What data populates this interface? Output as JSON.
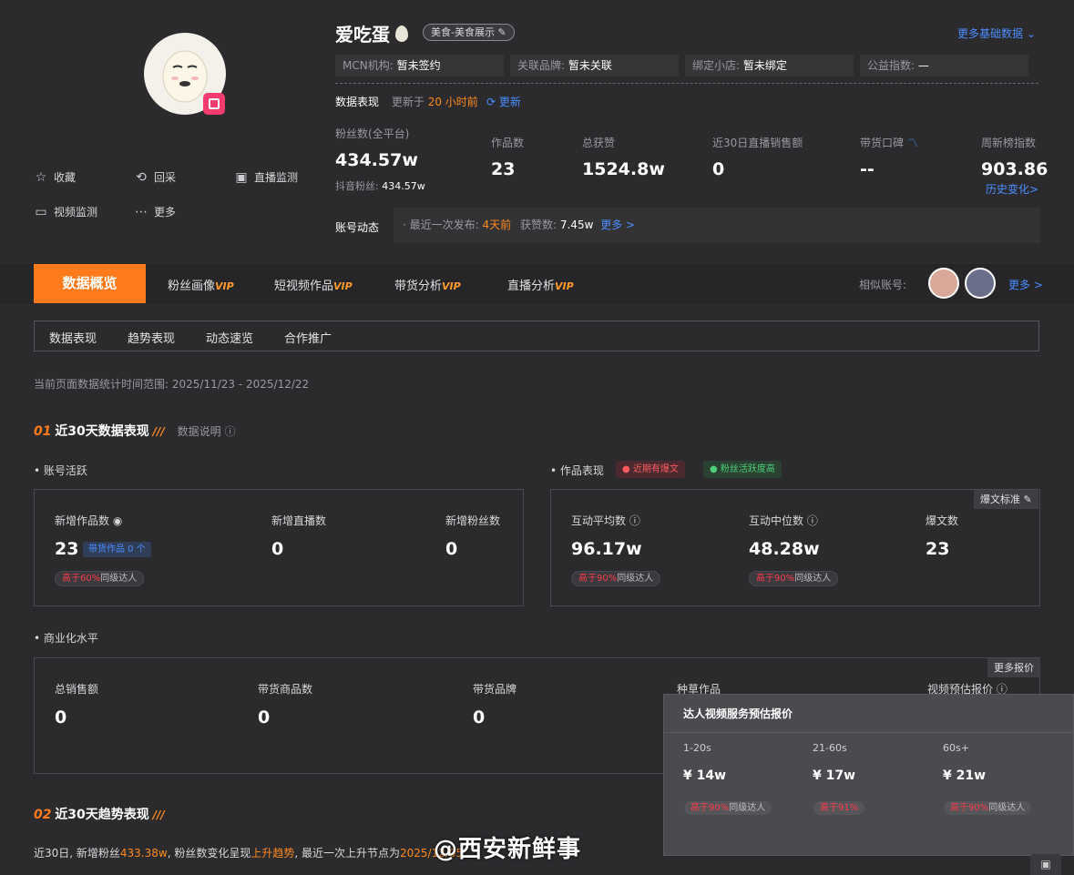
{
  "profile": {
    "name": "爱吃蛋",
    "category_tag": "美食-美食展示",
    "more_basic": "更多基础数据"
  },
  "actions": [
    {
      "label": "收藏",
      "icon": "star-icon"
    },
    {
      "label": "回采",
      "icon": "refresh-icon"
    },
    {
      "label": "直播监测",
      "icon": "live-icon"
    },
    {
      "label": "视频监测",
      "icon": "monitor-icon"
    },
    {
      "label": "更多",
      "icon": "more-icon"
    }
  ],
  "info": [
    {
      "label": "MCN机构:",
      "value": "暂未签约"
    },
    {
      "label": "关联品牌:",
      "value": "暂未关联"
    },
    {
      "label": "绑定小店:",
      "value": "暂未绑定"
    },
    {
      "label": "公益指数:",
      "value": "—"
    }
  ],
  "perf": {
    "title": "数据表现",
    "updated_prefix": "更新于",
    "updated_value": "20 小时前",
    "update_btn": "更新"
  },
  "stats": {
    "fans_label": "粉丝数(全平台)",
    "fans_value": "434.57w",
    "douyin_label": "抖音粉丝:",
    "douyin_value": "434.57w",
    "works_label": "作品数",
    "works_value": "23",
    "likes_label": "总获赞",
    "likes_value": "1524.8w",
    "live_sales_label": "近30日直播销售额",
    "live_sales_value": "0",
    "reputation_label": "带货口碑",
    "reputation_value": "--",
    "weekly_label": "周新榜指数",
    "weekly_value": "903.86",
    "history_link": "历史变化>"
  },
  "dynamics": {
    "label": "账号动态",
    "last_post_label": "· 最近一次发布:",
    "last_post_value": "4天前",
    "likes_label": "获赞数:",
    "likes_value": "7.45w",
    "more": "更多 >"
  },
  "tabs": {
    "active": "数据概览",
    "items": [
      "粉丝画像",
      "短视频作品",
      "带货分析",
      "直播分析"
    ],
    "vip": "VIP",
    "similar_label": "相似账号:",
    "similar_more": "更多 >"
  },
  "subtabs": [
    "数据表现",
    "趋势表现",
    "动态速览",
    "合作推广"
  ],
  "range_text": "当前页面数据统计时间范围: 2025/11/23 - 2025/12/22",
  "section1": {
    "num": "01",
    "title": "近30天数据表现",
    "desc": "数据说明"
  },
  "account_activity": {
    "title": "账号活跃",
    "new_works_label": "新增作品数",
    "new_works_value": "23",
    "goods_works": "带货作品 0 个",
    "new_works_pill_pre": "高于",
    "new_works_pill_pct": "60%",
    "new_works_pill_post": "同级达人",
    "new_live_label": "新增直播数",
    "new_live_value": "0",
    "new_fans_label": "新增粉丝数",
    "new_fans_value": "0"
  },
  "works_perf": {
    "title": "作品表现",
    "badge1": "近期有爆文",
    "badge2": "粉丝活跃度高",
    "standard_btn": "爆文标准",
    "avg_label": "互动平均数",
    "avg_value": "96.17w",
    "avg_pill_pre": "高于",
    "avg_pill_pct": "90%",
    "avg_pill_post": "同级达人",
    "median_label": "互动中位数",
    "median_value": "48.28w",
    "median_pill_pre": "高于",
    "median_pill_pct": "90%",
    "median_pill_post": "同级达人",
    "viral_label": "爆文数",
    "viral_value": "23"
  },
  "commerce": {
    "title": "商业化水平",
    "more_quote": "更多报价",
    "sales_label": "总销售额",
    "sales_value": "0",
    "goods_label": "带货商品数",
    "goods_value": "0",
    "brands_label": "带货品牌",
    "brands_value": "0",
    "seed_label": "种草作品",
    "quote_label": "视频预估报价"
  },
  "popup": {
    "title": "达人视频服务预估报价",
    "cols": [
      {
        "range": "1-20s",
        "price": "¥ 14w",
        "pill_pre": "高于",
        "pill_pct": "90%",
        "pill_post": "同级达人"
      },
      {
        "range": "21-60s",
        "price": "¥ 17w",
        "pill_pre": "高于",
        "pill_pct": "91%",
        "pill_post": ""
      },
      {
        "range": "60s+",
        "price": "¥ 21w",
        "pill_pre": "高于",
        "pill_pct": "90%",
        "pill_post": "同级达人"
      }
    ]
  },
  "section2": {
    "num": "02",
    "title": "近30天趋势表现"
  },
  "trend": {
    "p1": "近30日, 新增粉丝",
    "fans": "433.38w",
    "p2": ", 粉丝数变化呈现",
    "trend": "上升趋势",
    "p3": ", 最近一次上升节点为",
    "date": "2025/12/05"
  },
  "watermark": "@西安新鲜事"
}
